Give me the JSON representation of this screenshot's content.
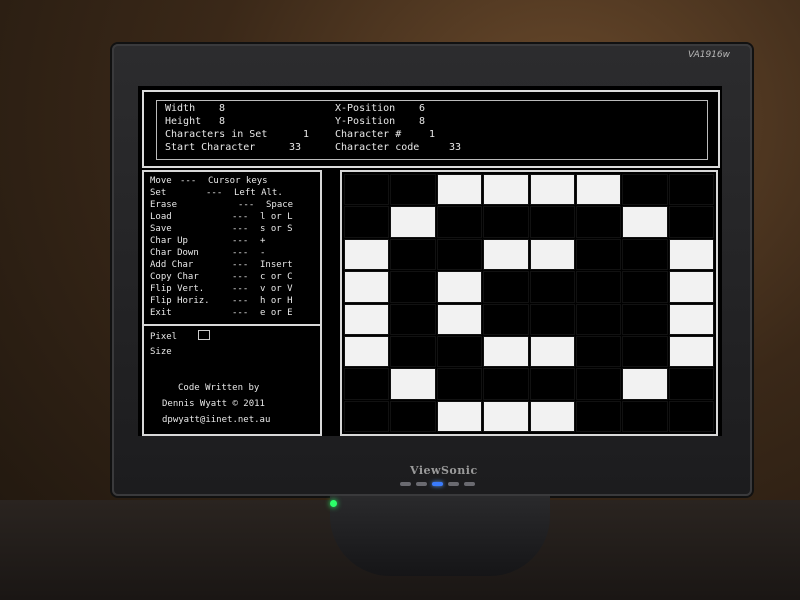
{
  "hardware": {
    "monitor_model": "VA1916w",
    "brand": "ViewSonic"
  },
  "info": {
    "width_label": "Width",
    "width_value": "8",
    "height_label": "Height",
    "height_value": "8",
    "chars_label": "Characters in Set",
    "chars_value": "1",
    "start_label": "Start Character",
    "start_value": "33",
    "xpos_label": "X-Position",
    "xpos_value": "6",
    "ypos_label": "Y-Position",
    "ypos_value": "8",
    "charnum_label": "Character #",
    "charnum_value": "1",
    "charcode_label": "Character code",
    "charcode_value": "33"
  },
  "help": [
    {
      "key": "Move",
      "dash": "---",
      "val": "Cursor keys"
    },
    {
      "key": "Set",
      "dash": "---",
      "val": "Left Alt."
    },
    {
      "key": "Erase",
      "dash": "---",
      "val": "Space"
    },
    {
      "key": "Load",
      "dash": "---",
      "val": "l or L"
    },
    {
      "key": "Save",
      "dash": "---",
      "val": "s or S"
    },
    {
      "key": "Char Up",
      "dash": "---",
      "val": "+"
    },
    {
      "key": "Char Down",
      "dash": "---",
      "val": "-"
    },
    {
      "key": "Add Char",
      "dash": "---",
      "val": "Insert"
    },
    {
      "key": "Copy Char",
      "dash": "---",
      "val": "c or C"
    },
    {
      "key": "Flip Vert.",
      "dash": "---",
      "val": "v or V"
    },
    {
      "key": "Flip Horiz.",
      "dash": "---",
      "val": "h or H"
    },
    {
      "key": "Exit",
      "dash": "---",
      "val": "e or E"
    }
  ],
  "pixel": {
    "pixel_label": "Pixel",
    "size_label": "Size"
  },
  "credits": {
    "line1": "Code Written by",
    "line2": "Dennis Wyatt © 2011",
    "line3": "dpwyatt@iinet.net.au"
  },
  "grid": {
    "rows": [
      [
        0,
        0,
        1,
        1,
        1,
        1,
        0,
        0
      ],
      [
        0,
        1,
        0,
        0,
        0,
        0,
        1,
        0
      ],
      [
        1,
        0,
        0,
        1,
        1,
        0,
        0,
        1
      ],
      [
        1,
        0,
        1,
        0,
        0,
        0,
        0,
        1
      ],
      [
        1,
        0,
        1,
        0,
        0,
        0,
        0,
        1
      ],
      [
        1,
        0,
        0,
        1,
        1,
        0,
        0,
        1
      ],
      [
        0,
        1,
        0,
        0,
        0,
        0,
        1,
        0
      ],
      [
        0,
        0,
        1,
        1,
        1,
        0,
        0,
        0
      ]
    ]
  },
  "colors": {
    "screen_bg": "#000000",
    "pixel_on": "#f2f2f2",
    "text": "#e8e8e8",
    "power_led": "#3a7cff"
  }
}
